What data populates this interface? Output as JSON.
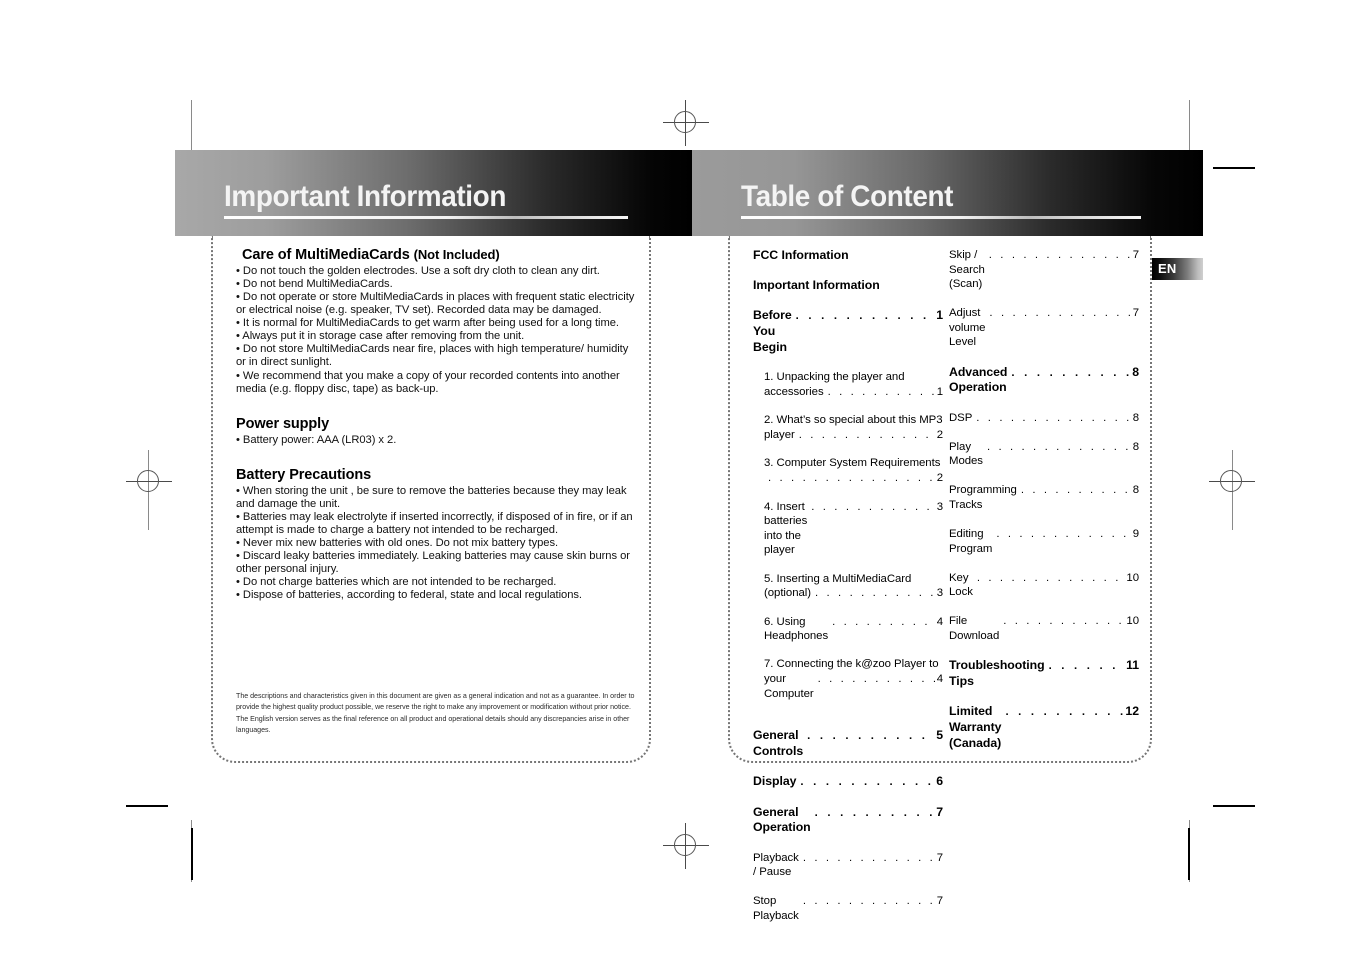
{
  "left_page": {
    "header_title": "Important Information",
    "sections": [
      {
        "heading": "Care of  MultiMediaCards",
        "heading_suffix": "(Not Included)",
        "bullets": [
          "• Do not touch the golden electrodes. Use a soft dry cloth to clean any dirt.",
          "• Do not bend MultiMediaCards.",
          "• Do not operate or store MultiMediaCards in places with frequent static electricity or electrical noise (e.g. speaker, TV set). Recorded data may be damaged.",
          "• It is normal for MultiMediaCards to get warm after being used for a long time.",
          "• Always put it in storage case after removing from the unit.",
          "• Do not store MultiMediaCards near fire, places with high temperature/ humidity or in direct sunlight.",
          "• We recommend that you make a copy of your recorded contents into another media (e.g. floppy disc, tape) as back-up."
        ]
      },
      {
        "heading": "Power supply",
        "heading_suffix": "",
        "bullets": [
          "• Battery power: AAA (LR03) x 2."
        ]
      },
      {
        "heading": "Battery Precautions",
        "heading_suffix": "",
        "bullets": [
          "• When storing the unit , be sure to remove the batteries because they may leak and damage the unit.",
          "• Batteries may leak electrolyte if inserted incorrectly, if disposed of in fire, or if an attempt is made to charge a battery not intended to be recharged.",
          "• Never mix new batteries with old ones. Do not mix battery types.",
          "• Discard leaky batteries immediately.  Leaking batteries may cause skin burns or other personal injury.",
          "• Do not charge batteries which are not intended to be recharged.",
          "• Dispose of batteries, according to federal, state and local regulations."
        ]
      }
    ],
    "disclaimer": "The descriptions and characteristics given in this document are given as a general indication and not as a guarantee.  In order to provide the highest quality product possible, we reserve the right to make any improvement or modification without prior notice. The English version serves as the final reference on all product and operational details should any discrepancies arise in other languages."
  },
  "right_page": {
    "header_title": "Table of Content",
    "language_tab": "EN",
    "toc_col_1": [
      {
        "style": "head",
        "label": "FCC Information",
        "page": "",
        "leader": false
      },
      {
        "style": "head",
        "label": "Important Information",
        "page": "",
        "leader": false
      },
      {
        "style": "head",
        "label": "Before You Begin",
        "page": "1",
        "leader": true
      },
      {
        "style": "wrap",
        "line1": "1.  Unpacking the player and",
        "line2": "accessories",
        "page": "1"
      },
      {
        "style": "wrap",
        "line1": "2.  What’s so special about this MP3",
        "line2": "player",
        "page": "2"
      },
      {
        "style": "wrap",
        "line1": "3.  Computer System Requirements",
        "line2": "",
        "page": "2"
      },
      {
        "style": "sub",
        "label": "4.  Insert batteries into the player",
        "page": "3",
        "leader": true
      },
      {
        "style": "wrap",
        "line1": "5.  Inserting a MultiMediaCard",
        "line2": "(optional)",
        "page": "3"
      },
      {
        "style": "sub",
        "label": "6.   Using Headphones",
        "page": "4",
        "leader": true
      },
      {
        "style": "wrap",
        "line1": "7.   Connecting the k@zoo Player to",
        "line2": "your Computer",
        "page": "4"
      },
      {
        "style": "spacer"
      },
      {
        "style": "head",
        "label": "General Controls",
        "page": "5",
        "leader": true
      },
      {
        "style": "head",
        "label": "Display",
        "page": "6",
        "leader": true
      },
      {
        "style": "head",
        "label": "General Operation",
        "page": "7",
        "leader": true
      },
      {
        "style": "plain",
        "label": "Playback / Pause",
        "page": "7",
        "leader": true
      },
      {
        "style": "plain",
        "label": "Stop Playback",
        "page": "7",
        "leader": true
      }
    ],
    "toc_col_2": [
      {
        "style": "plain",
        "label": "Skip / Search (Scan)",
        "page": "7",
        "leader": true
      },
      {
        "style": "plain",
        "label": "Adjust volume Level",
        "page": "7",
        "leader": true
      },
      {
        "style": "head",
        "label": "Advanced Operation",
        "page": "8",
        "leader": true
      },
      {
        "style": "plain",
        "label": "DSP",
        "page": "8",
        "leader": true
      },
      {
        "style": "plain",
        "label": "Play Modes",
        "page": "8",
        "leader": true
      },
      {
        "style": "plain",
        "label": "Programming Tracks",
        "page": "8",
        "leader": true
      },
      {
        "style": "plain",
        "label": "Editing Program",
        "page": "9",
        "leader": true
      },
      {
        "style": "plain",
        "label": "Key Lock",
        "page": "10",
        "leader": true
      },
      {
        "style": "plain",
        "label": "File Download",
        "page": "10",
        "leader": true
      },
      {
        "style": "head",
        "label": "Troubleshooting Tips",
        "page": "11",
        "leader": true
      },
      {
        "style": "head",
        "label": "Limited Warranty (Canada)",
        "page": "12",
        "leader": true
      }
    ]
  },
  "print_marks": {
    "leader_dots": ". . . . . . . . . . . . . . . . . . . . . . . . . . . . . . . . . . . . . . . . . ."
  }
}
